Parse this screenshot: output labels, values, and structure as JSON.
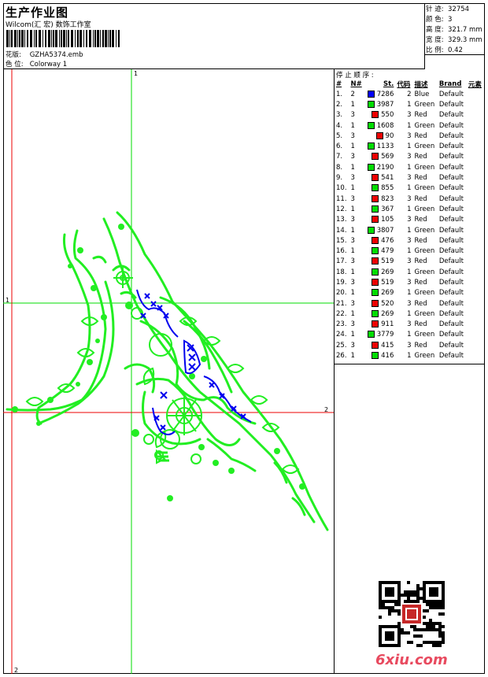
{
  "header": {
    "title": "生产作业图",
    "subtitle": "Wilcom(汇 宏) 数饰工作室",
    "design_label": "花版:",
    "design_value": "GZHA5374.emb",
    "colorway_label": "色 位:",
    "colorway_value": "Colorway 1"
  },
  "stats": [
    {
      "label": "针 迹:",
      "value": "32754"
    },
    {
      "label": "颜 色:",
      "value": "3"
    },
    {
      "label": "高 度:",
      "value": "321.7 mm"
    },
    {
      "label": "宽 度:",
      "value": "329.3 mm"
    },
    {
      "label": "比 例:",
      "value": "0.42"
    }
  ],
  "sequence": {
    "title": "停 止 顺 序 :",
    "headers": [
      "#",
      "N#",
      "St.",
      "代码",
      "描述",
      "Brand",
      "元素"
    ],
    "rows": [
      {
        "n": "1.",
        "nn": "2",
        "color": "#0000ff",
        "st": "7286",
        "code": "2",
        "desc": "Blue",
        "brand": "Default"
      },
      {
        "n": "2.",
        "nn": "1",
        "color": "#00dd00",
        "st": "3987",
        "code": "1",
        "desc": "Green",
        "brand": "Default"
      },
      {
        "n": "3.",
        "nn": "3",
        "color": "#ee0000",
        "st": "550",
        "code": "3",
        "desc": "Red",
        "brand": "Default"
      },
      {
        "n": "4.",
        "nn": "1",
        "color": "#00dd00",
        "st": "1608",
        "code": "1",
        "desc": "Green",
        "brand": "Default"
      },
      {
        "n": "5.",
        "nn": "3",
        "color": "#ee0000",
        "st": "90",
        "code": "3",
        "desc": "Red",
        "brand": "Default"
      },
      {
        "n": "6.",
        "nn": "1",
        "color": "#00dd00",
        "st": "1133",
        "code": "1",
        "desc": "Green",
        "brand": "Default"
      },
      {
        "n": "7.",
        "nn": "3",
        "color": "#ee0000",
        "st": "569",
        "code": "3",
        "desc": "Red",
        "brand": "Default"
      },
      {
        "n": "8.",
        "nn": "1",
        "color": "#00dd00",
        "st": "2190",
        "code": "1",
        "desc": "Green",
        "brand": "Default"
      },
      {
        "n": "9.",
        "nn": "3",
        "color": "#ee0000",
        "st": "541",
        "code": "3",
        "desc": "Red",
        "brand": "Default"
      },
      {
        "n": "10.",
        "nn": "1",
        "color": "#00dd00",
        "st": "855",
        "code": "1",
        "desc": "Green",
        "brand": "Default"
      },
      {
        "n": "11.",
        "nn": "3",
        "color": "#ee0000",
        "st": "823",
        "code": "3",
        "desc": "Red",
        "brand": "Default"
      },
      {
        "n": "12.",
        "nn": "1",
        "color": "#00dd00",
        "st": "367",
        "code": "1",
        "desc": "Green",
        "brand": "Default"
      },
      {
        "n": "13.",
        "nn": "3",
        "color": "#ee0000",
        "st": "105",
        "code": "3",
        "desc": "Red",
        "brand": "Default"
      },
      {
        "n": "14.",
        "nn": "1",
        "color": "#00dd00",
        "st": "3807",
        "code": "1",
        "desc": "Green",
        "brand": "Default"
      },
      {
        "n": "15.",
        "nn": "3",
        "color": "#ee0000",
        "st": "476",
        "code": "3",
        "desc": "Red",
        "brand": "Default"
      },
      {
        "n": "16.",
        "nn": "1",
        "color": "#00dd00",
        "st": "479",
        "code": "1",
        "desc": "Green",
        "brand": "Default"
      },
      {
        "n": "17.",
        "nn": "3",
        "color": "#ee0000",
        "st": "519",
        "code": "3",
        "desc": "Red",
        "brand": "Default"
      },
      {
        "n": "18.",
        "nn": "1",
        "color": "#00dd00",
        "st": "269",
        "code": "1",
        "desc": "Green",
        "brand": "Default"
      },
      {
        "n": "19.",
        "nn": "3",
        "color": "#ee0000",
        "st": "519",
        "code": "3",
        "desc": "Red",
        "brand": "Default"
      },
      {
        "n": "20.",
        "nn": "1",
        "color": "#00dd00",
        "st": "269",
        "code": "1",
        "desc": "Green",
        "brand": "Default"
      },
      {
        "n": "21.",
        "nn": "3",
        "color": "#ee0000",
        "st": "520",
        "code": "3",
        "desc": "Red",
        "brand": "Default"
      },
      {
        "n": "22.",
        "nn": "1",
        "color": "#00dd00",
        "st": "269",
        "code": "1",
        "desc": "Green",
        "brand": "Default"
      },
      {
        "n": "23.",
        "nn": "3",
        "color": "#ee0000",
        "st": "911",
        "code": "3",
        "desc": "Red",
        "brand": "Default"
      },
      {
        "n": "24.",
        "nn": "1",
        "color": "#00dd00",
        "st": "3779",
        "code": "1",
        "desc": "Green",
        "brand": "Default"
      },
      {
        "n": "25.",
        "nn": "3",
        "color": "#ee0000",
        "st": "415",
        "code": "3",
        "desc": "Red",
        "brand": "Default"
      },
      {
        "n": "26.",
        "nn": "1",
        "color": "#00dd00",
        "st": "416",
        "code": "1",
        "desc": "Green",
        "brand": "Default"
      }
    ]
  },
  "canvas": {
    "axis_labels": {
      "v1_top": "1",
      "h1_left": "1",
      "h2_right": "2",
      "v2_bottom": "2"
    },
    "guide_green": "#00dd00",
    "guide_red": "#ee0000",
    "design_green": "#22ee22",
    "design_blue": "#0000ee"
  },
  "watermark": {
    "text": "6xiu.com",
    "color": "#e84a5f"
  }
}
